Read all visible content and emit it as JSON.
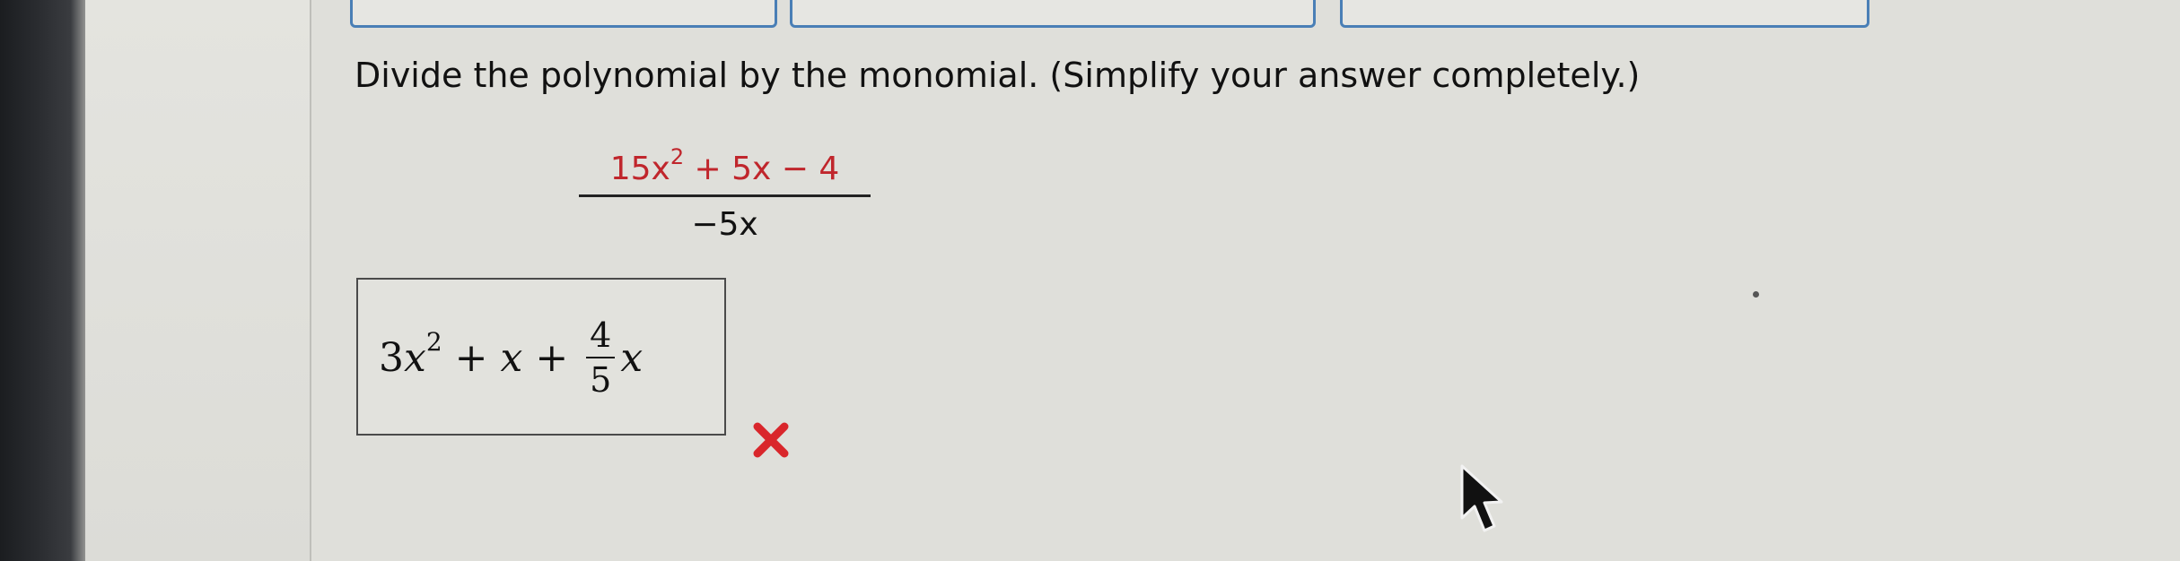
{
  "question": {
    "prompt": "Divide the polynomial by the monomial. (Simplify your answer completely.)",
    "numerator": "15x",
    "numerator_exp": "2",
    "numerator_rest": " + 5x − 4",
    "denominator": "−5x"
  },
  "answer": {
    "coef1": "3",
    "var1": "x",
    "exp1": "2",
    "plus1": " + ",
    "var2": "x",
    "plus2": " + ",
    "frac_num": "4",
    "frac_den": "5",
    "var3": "x"
  },
  "feedback": {
    "icon": "incorrect-x-icon",
    "color": "#d9262b"
  },
  "colors": {
    "accent": "#4a7fb6",
    "numerator": "#c0262c"
  }
}
